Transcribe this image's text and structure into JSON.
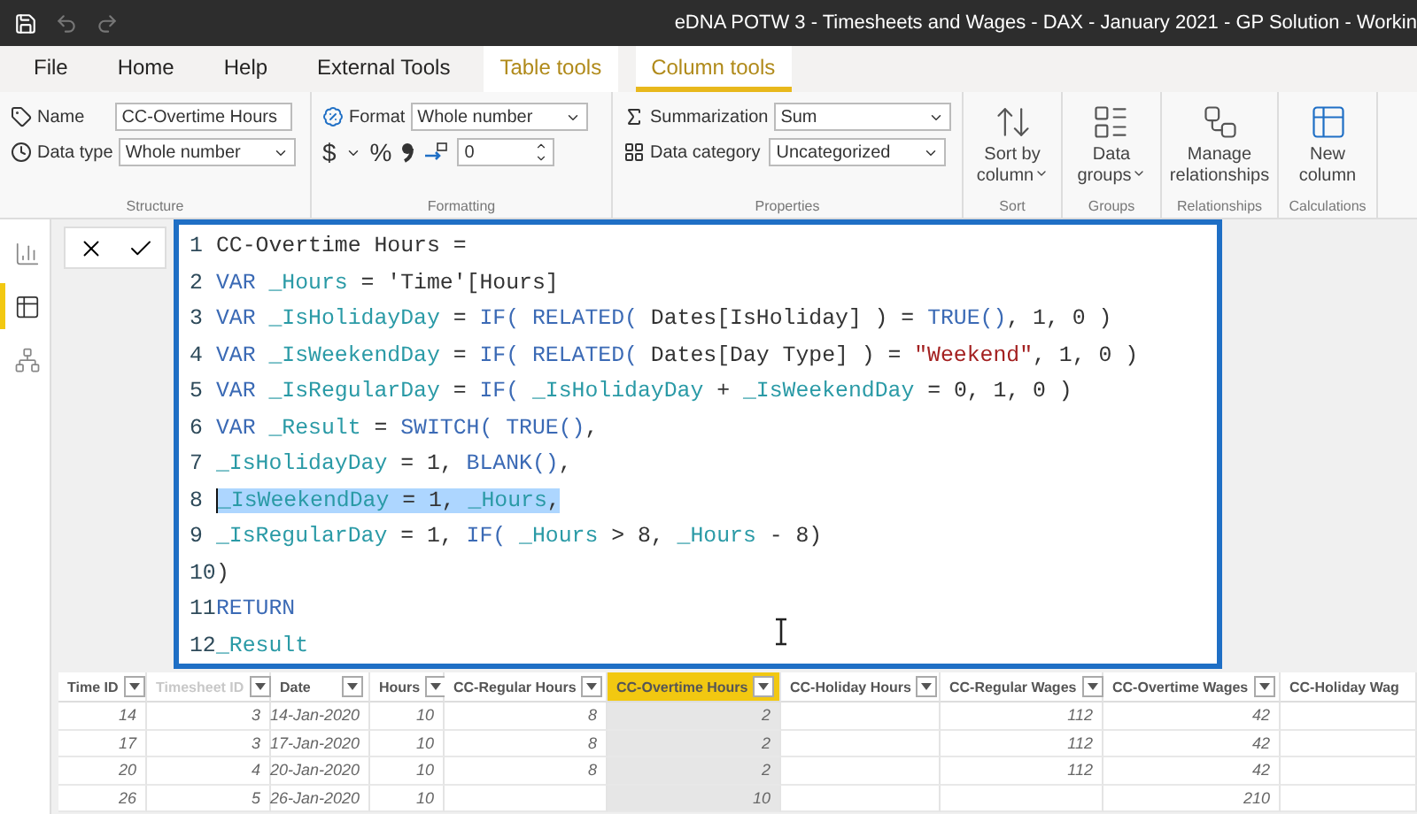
{
  "title_bar": {
    "title": "eDNA POTW 3 - Timesheets and Wages - DAX - January 2021 - GP Solution - Workin"
  },
  "tabs": [
    {
      "label": "File",
      "selected": false,
      "contextual": false
    },
    {
      "label": "Home",
      "selected": false,
      "contextual": false
    },
    {
      "label": "Help",
      "selected": false,
      "contextual": false
    },
    {
      "label": "External Tools",
      "selected": false,
      "contextual": false
    },
    {
      "label": "Table tools",
      "selected": false,
      "contextual": true
    },
    {
      "label": "Column tools",
      "selected": true,
      "contextual": true
    }
  ],
  "structure": {
    "name_label": "Name",
    "name_value": "CC-Overtime Hours",
    "data_type_label": "Data type",
    "data_type_value": "Whole number",
    "group_label": "Structure"
  },
  "formatting": {
    "format_label": "Format",
    "format_value": "Whole number",
    "currency_symbol": "$",
    "percent_symbol": "%",
    "decimal_places": "0",
    "group_label": "Formatting"
  },
  "properties": {
    "summarization_label": "Summarization",
    "summarization_value": "Sum",
    "data_category_label": "Data category",
    "data_category_value": "Uncategorized",
    "group_label": "Properties"
  },
  "command_groups": [
    {
      "group_label": "Sort",
      "button": {
        "kind": "sort",
        "lines": [
          "Sort by",
          "column"
        ],
        "dropdown": true
      }
    },
    {
      "group_label": "Groups",
      "button": {
        "kind": "groups",
        "lines": [
          "Data",
          "groups"
        ],
        "dropdown": true
      }
    },
    {
      "group_label": "Relationships",
      "button": {
        "kind": "relationships",
        "lines": [
          "Manage",
          "relationships"
        ],
        "dropdown": false
      }
    },
    {
      "group_label": "Calculations",
      "button": {
        "kind": "column",
        "lines": [
          "New",
          "column"
        ],
        "dropdown": false
      }
    }
  ],
  "views": [
    {
      "kind": "report",
      "selected": false
    },
    {
      "kind": "table",
      "selected": true
    },
    {
      "kind": "model",
      "selected": false
    }
  ],
  "formula_bar": {
    "lines": [
      {
        "number": "1",
        "selected": false,
        "tokens": [
          {
            "t": "CC-Overtime Hours =",
            "kind": "plain"
          }
        ]
      },
      {
        "number": "2",
        "selected": false,
        "tokens": [
          {
            "t": "VAR",
            "kind": "keyword"
          },
          {
            "t": " _Hours",
            "kind": "variable"
          },
          {
            "t": " = 'Time'[Hours]",
            "kind": "plain"
          }
        ]
      },
      {
        "number": "3",
        "selected": false,
        "tokens": [
          {
            "t": "VAR",
            "kind": "keyword"
          },
          {
            "t": " _IsHolidayDay",
            "kind": "variable"
          },
          {
            "t": " = ",
            "kind": "plain"
          },
          {
            "t": "IF(",
            "kind": "keyword"
          },
          {
            "t": " RELATED(",
            "kind": "keyword"
          },
          {
            "t": " Dates[IsHoliday] ) = ",
            "kind": "plain"
          },
          {
            "t": "TRUE()",
            "kind": "keyword"
          },
          {
            "t": ", 1, 0 )",
            "kind": "plain"
          }
        ]
      },
      {
        "number": "4",
        "selected": false,
        "tokens": [
          {
            "t": "VAR",
            "kind": "keyword"
          },
          {
            "t": " _IsWeekendDay",
            "kind": "variable"
          },
          {
            "t": " = ",
            "kind": "plain"
          },
          {
            "t": "IF(",
            "kind": "keyword"
          },
          {
            "t": " RELATED(",
            "kind": "keyword"
          },
          {
            "t": " Dates[Day Type] ) = ",
            "kind": "plain"
          },
          {
            "t": "\"Weekend\"",
            "kind": "string"
          },
          {
            "t": ", 1, 0 )",
            "kind": "plain"
          }
        ]
      },
      {
        "number": "5",
        "selected": false,
        "tokens": [
          {
            "t": "VAR",
            "kind": "keyword"
          },
          {
            "t": " _IsRegularDay",
            "kind": "variable"
          },
          {
            "t": " = ",
            "kind": "plain"
          },
          {
            "t": "IF(",
            "kind": "keyword"
          },
          {
            "t": " _IsHolidayDay",
            "kind": "variable"
          },
          {
            "t": " + ",
            "kind": "plain"
          },
          {
            "t": "_IsWeekendDay",
            "kind": "variable"
          },
          {
            "t": " = 0, 1, 0 )",
            "kind": "plain"
          }
        ]
      },
      {
        "number": "6",
        "selected": false,
        "tokens": [
          {
            "t": "VAR",
            "kind": "keyword"
          },
          {
            "t": " _Result",
            "kind": "variable"
          },
          {
            "t": " = ",
            "kind": "plain"
          },
          {
            "t": "SWITCH(",
            "kind": "keyword"
          },
          {
            "t": " TRUE()",
            "kind": "keyword"
          },
          {
            "t": ",",
            "kind": "plain"
          }
        ]
      },
      {
        "number": "7",
        "selected": false,
        "tokens": [
          {
            "t": "_IsHolidayDay",
            "kind": "variable"
          },
          {
            "t": " = 1, ",
            "kind": "plain"
          },
          {
            "t": "BLANK()",
            "kind": "keyword"
          },
          {
            "t": ",",
            "kind": "plain"
          }
        ]
      },
      {
        "number": "8",
        "selected": true,
        "tokens": [
          {
            "t": "_IsWeekendDay",
            "kind": "variable"
          },
          {
            "t": " = 1, ",
            "kind": "plain"
          },
          {
            "t": "_Hours",
            "kind": "variable"
          },
          {
            "t": ",",
            "kind": "plain"
          }
        ]
      },
      {
        "number": "9",
        "selected": false,
        "tokens": [
          {
            "t": "_IsRegularDay",
            "kind": "variable"
          },
          {
            "t": " = 1, ",
            "kind": "plain"
          },
          {
            "t": "IF(",
            "kind": "keyword"
          },
          {
            "t": " _Hours",
            "kind": "variable"
          },
          {
            "t": " > 8, ",
            "kind": "plain"
          },
          {
            "t": "_Hours",
            "kind": "variable"
          },
          {
            "t": " - 8)",
            "kind": "plain"
          }
        ]
      },
      {
        "number": "10",
        "selected": false,
        "tokens": [
          {
            "t": ")",
            "kind": "plain"
          }
        ]
      },
      {
        "number": "11",
        "selected": false,
        "tokens": [
          {
            "t": "RETURN",
            "kind": "keyword"
          }
        ]
      },
      {
        "number": "12",
        "selected": false,
        "tokens": [
          {
            "t": "_Result",
            "kind": "variable"
          }
        ]
      }
    ]
  },
  "table": {
    "columns": [
      {
        "label": "Time ID",
        "selected": false,
        "hidden": false
      },
      {
        "label": "Timesheet ID",
        "selected": false,
        "hidden": true
      },
      {
        "label": "Date",
        "selected": false,
        "hidden": false
      },
      {
        "label": "Hours",
        "selected": false,
        "hidden": false
      },
      {
        "label": "CC-Regular Hours",
        "selected": false,
        "hidden": false
      },
      {
        "label": "CC-Overtime Hours",
        "selected": true,
        "hidden": false
      },
      {
        "label": "CC-Holiday Hours",
        "selected": false,
        "hidden": false
      },
      {
        "label": "CC-Regular Wages",
        "selected": false,
        "hidden": false
      },
      {
        "label": "CC-Overtime Wages",
        "selected": false,
        "hidden": false
      },
      {
        "label": "CC-Holiday Wag",
        "selected": false,
        "hidden": false
      }
    ],
    "rows": [
      [
        "14",
        "3",
        "14-Jan-2020",
        "10",
        "8",
        "2",
        null,
        "112",
        "42",
        null
      ],
      [
        "17",
        "3",
        "17-Jan-2020",
        "10",
        "8",
        "2",
        null,
        "112",
        "42",
        null
      ],
      [
        "20",
        "4",
        "20-Jan-2020",
        "10",
        "8",
        "2",
        null,
        "112",
        "42",
        null
      ],
      [
        "26",
        "5",
        "26-Jan-2020",
        "10",
        null,
        "10",
        null,
        null,
        "210",
        null
      ]
    ]
  }
}
